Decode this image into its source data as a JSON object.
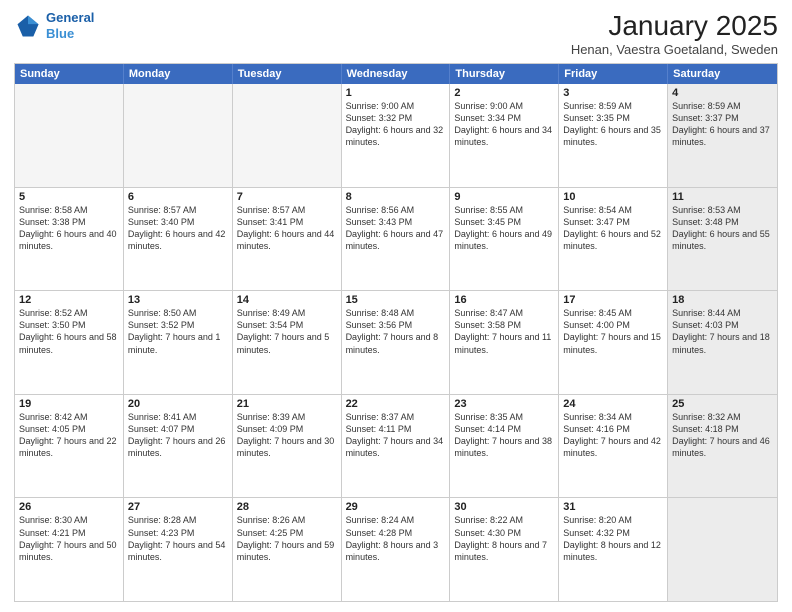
{
  "header": {
    "logo_line1": "General",
    "logo_line2": "Blue",
    "month": "January 2025",
    "location": "Henan, Vaestra Goetaland, Sweden"
  },
  "weekdays": [
    "Sunday",
    "Monday",
    "Tuesday",
    "Wednesday",
    "Thursday",
    "Friday",
    "Saturday"
  ],
  "rows": [
    [
      {
        "day": "",
        "text": "",
        "empty": true
      },
      {
        "day": "",
        "text": "",
        "empty": true
      },
      {
        "day": "",
        "text": "",
        "empty": true
      },
      {
        "day": "1",
        "text": "Sunrise: 9:00 AM\nSunset: 3:32 PM\nDaylight: 6 hours and 32 minutes."
      },
      {
        "day": "2",
        "text": "Sunrise: 9:00 AM\nSunset: 3:34 PM\nDaylight: 6 hours and 34 minutes."
      },
      {
        "day": "3",
        "text": "Sunrise: 8:59 AM\nSunset: 3:35 PM\nDaylight: 6 hours and 35 minutes."
      },
      {
        "day": "4",
        "text": "Sunrise: 8:59 AM\nSunset: 3:37 PM\nDaylight: 6 hours and 37 minutes.",
        "shaded": true
      }
    ],
    [
      {
        "day": "5",
        "text": "Sunrise: 8:58 AM\nSunset: 3:38 PM\nDaylight: 6 hours and 40 minutes."
      },
      {
        "day": "6",
        "text": "Sunrise: 8:57 AM\nSunset: 3:40 PM\nDaylight: 6 hours and 42 minutes."
      },
      {
        "day": "7",
        "text": "Sunrise: 8:57 AM\nSunset: 3:41 PM\nDaylight: 6 hours and 44 minutes."
      },
      {
        "day": "8",
        "text": "Sunrise: 8:56 AM\nSunset: 3:43 PM\nDaylight: 6 hours and 47 minutes."
      },
      {
        "day": "9",
        "text": "Sunrise: 8:55 AM\nSunset: 3:45 PM\nDaylight: 6 hours and 49 minutes."
      },
      {
        "day": "10",
        "text": "Sunrise: 8:54 AM\nSunset: 3:47 PM\nDaylight: 6 hours and 52 minutes."
      },
      {
        "day": "11",
        "text": "Sunrise: 8:53 AM\nSunset: 3:48 PM\nDaylight: 6 hours and 55 minutes.",
        "shaded": true
      }
    ],
    [
      {
        "day": "12",
        "text": "Sunrise: 8:52 AM\nSunset: 3:50 PM\nDaylight: 6 hours and 58 minutes."
      },
      {
        "day": "13",
        "text": "Sunrise: 8:50 AM\nSunset: 3:52 PM\nDaylight: 7 hours and 1 minute."
      },
      {
        "day": "14",
        "text": "Sunrise: 8:49 AM\nSunset: 3:54 PM\nDaylight: 7 hours and 5 minutes."
      },
      {
        "day": "15",
        "text": "Sunrise: 8:48 AM\nSunset: 3:56 PM\nDaylight: 7 hours and 8 minutes."
      },
      {
        "day": "16",
        "text": "Sunrise: 8:47 AM\nSunset: 3:58 PM\nDaylight: 7 hours and 11 minutes."
      },
      {
        "day": "17",
        "text": "Sunrise: 8:45 AM\nSunset: 4:00 PM\nDaylight: 7 hours and 15 minutes."
      },
      {
        "day": "18",
        "text": "Sunrise: 8:44 AM\nSunset: 4:03 PM\nDaylight: 7 hours and 18 minutes.",
        "shaded": true
      }
    ],
    [
      {
        "day": "19",
        "text": "Sunrise: 8:42 AM\nSunset: 4:05 PM\nDaylight: 7 hours and 22 minutes."
      },
      {
        "day": "20",
        "text": "Sunrise: 8:41 AM\nSunset: 4:07 PM\nDaylight: 7 hours and 26 minutes."
      },
      {
        "day": "21",
        "text": "Sunrise: 8:39 AM\nSunset: 4:09 PM\nDaylight: 7 hours and 30 minutes."
      },
      {
        "day": "22",
        "text": "Sunrise: 8:37 AM\nSunset: 4:11 PM\nDaylight: 7 hours and 34 minutes."
      },
      {
        "day": "23",
        "text": "Sunrise: 8:35 AM\nSunset: 4:14 PM\nDaylight: 7 hours and 38 minutes."
      },
      {
        "day": "24",
        "text": "Sunrise: 8:34 AM\nSunset: 4:16 PM\nDaylight: 7 hours and 42 minutes."
      },
      {
        "day": "25",
        "text": "Sunrise: 8:32 AM\nSunset: 4:18 PM\nDaylight: 7 hours and 46 minutes.",
        "shaded": true
      }
    ],
    [
      {
        "day": "26",
        "text": "Sunrise: 8:30 AM\nSunset: 4:21 PM\nDaylight: 7 hours and 50 minutes."
      },
      {
        "day": "27",
        "text": "Sunrise: 8:28 AM\nSunset: 4:23 PM\nDaylight: 7 hours and 54 minutes."
      },
      {
        "day": "28",
        "text": "Sunrise: 8:26 AM\nSunset: 4:25 PM\nDaylight: 7 hours and 59 minutes."
      },
      {
        "day": "29",
        "text": "Sunrise: 8:24 AM\nSunset: 4:28 PM\nDaylight: 8 hours and 3 minutes."
      },
      {
        "day": "30",
        "text": "Sunrise: 8:22 AM\nSunset: 4:30 PM\nDaylight: 8 hours and 7 minutes."
      },
      {
        "day": "31",
        "text": "Sunrise: 8:20 AM\nSunset: 4:32 PM\nDaylight: 8 hours and 12 minutes."
      },
      {
        "day": "",
        "text": "",
        "empty": true,
        "shaded": true
      }
    ]
  ]
}
